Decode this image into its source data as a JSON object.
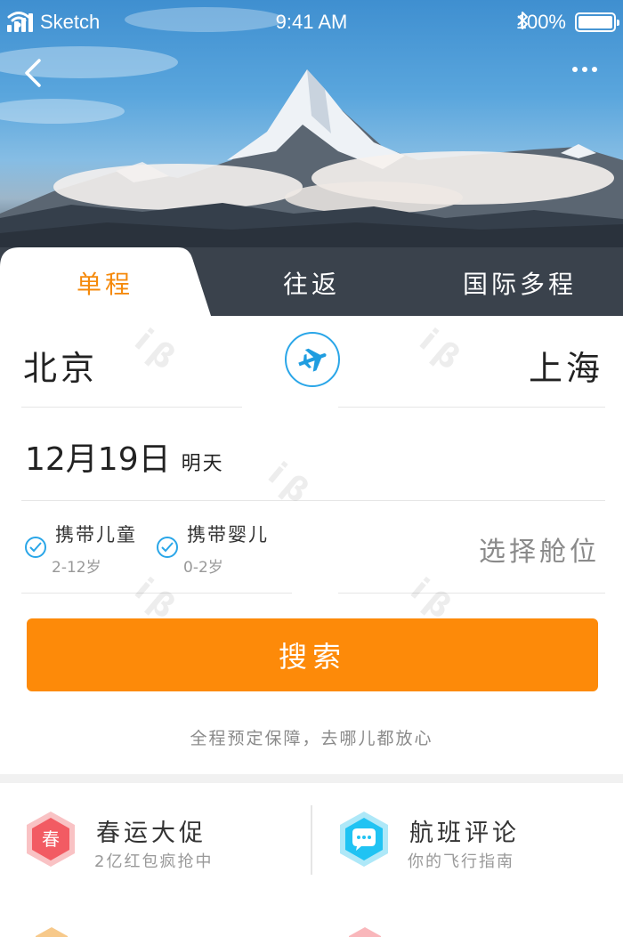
{
  "status_bar": {
    "carrier": "Sketch",
    "time": "9:41 AM",
    "battery": "100%",
    "battery_level": 1.0
  },
  "tabs": [
    {
      "label": "单程",
      "active": true
    },
    {
      "label": "往返",
      "active": false
    },
    {
      "label": "国际多程",
      "active": false
    }
  ],
  "route": {
    "from": "北京",
    "to": "上海"
  },
  "date": {
    "main": "12月19日",
    "sub": "明天"
  },
  "options": [
    {
      "title": "携带儿童",
      "sub": "2-12岁",
      "checked": true
    },
    {
      "title": "携带婴儿",
      "sub": "0-2岁",
      "checked": true
    }
  ],
  "cabin_placeholder": "选择舱位",
  "search_label": "搜索",
  "guarantee": "全程预定保障，去哪儿都放心",
  "promos": [
    {
      "title": "春运大促",
      "sub": "2亿红包疯抢中",
      "icon_char": "春",
      "icon": "spring-hexagon-icon",
      "color": "#f25b63"
    },
    {
      "title": "航班评论",
      "sub": "你的飞行指南",
      "icon": "chat-bubble-hexagon-icon",
      "color": "#20c3f3"
    }
  ],
  "colors": {
    "accent": "#fd8a09",
    "blue": "#2aa6e8"
  }
}
